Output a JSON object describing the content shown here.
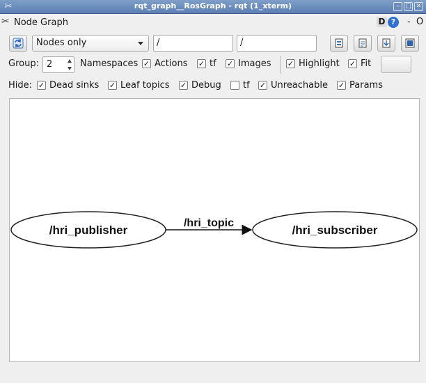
{
  "window": {
    "title": "rqt_graph__RosGraph - rqt (1_xterm)"
  },
  "plugin": {
    "title": "Node Graph",
    "d_label": "D",
    "help_label": "?",
    "dash_label": "-",
    "close_label": "O"
  },
  "toolbar": {
    "mode_combo": "Nodes only",
    "node_filter": "/",
    "topic_filter": "/"
  },
  "options": {
    "group_label": "Group:",
    "group_value": "2",
    "namespaces_label": "Namespaces",
    "namespaces_checked": true,
    "actions_label": "Actions",
    "actions_checked": true,
    "tf_label": "tf",
    "tf_checked": true,
    "images_label": "Images",
    "images_checked": true,
    "highlight_label": "Highlight",
    "highlight_checked": true,
    "fit_label": "Fit",
    "fit_checked": true
  },
  "hide": {
    "label": "Hide:",
    "dead_sinks": "Dead sinks",
    "dead_sinks_checked": true,
    "leaf_topics": "Leaf topics",
    "leaf_topics_checked": true,
    "debug": "Debug",
    "debug_checked": true,
    "tf": "tf",
    "tf_checked": false,
    "unreachable": "Unreachable",
    "unreachable_checked": true,
    "params": "Params",
    "params_checked": true
  },
  "graph": {
    "publisher": "/hri_publisher",
    "subscriber": "/hri_subscriber",
    "topic": "/hri_topic"
  },
  "check_glyph": "✓"
}
